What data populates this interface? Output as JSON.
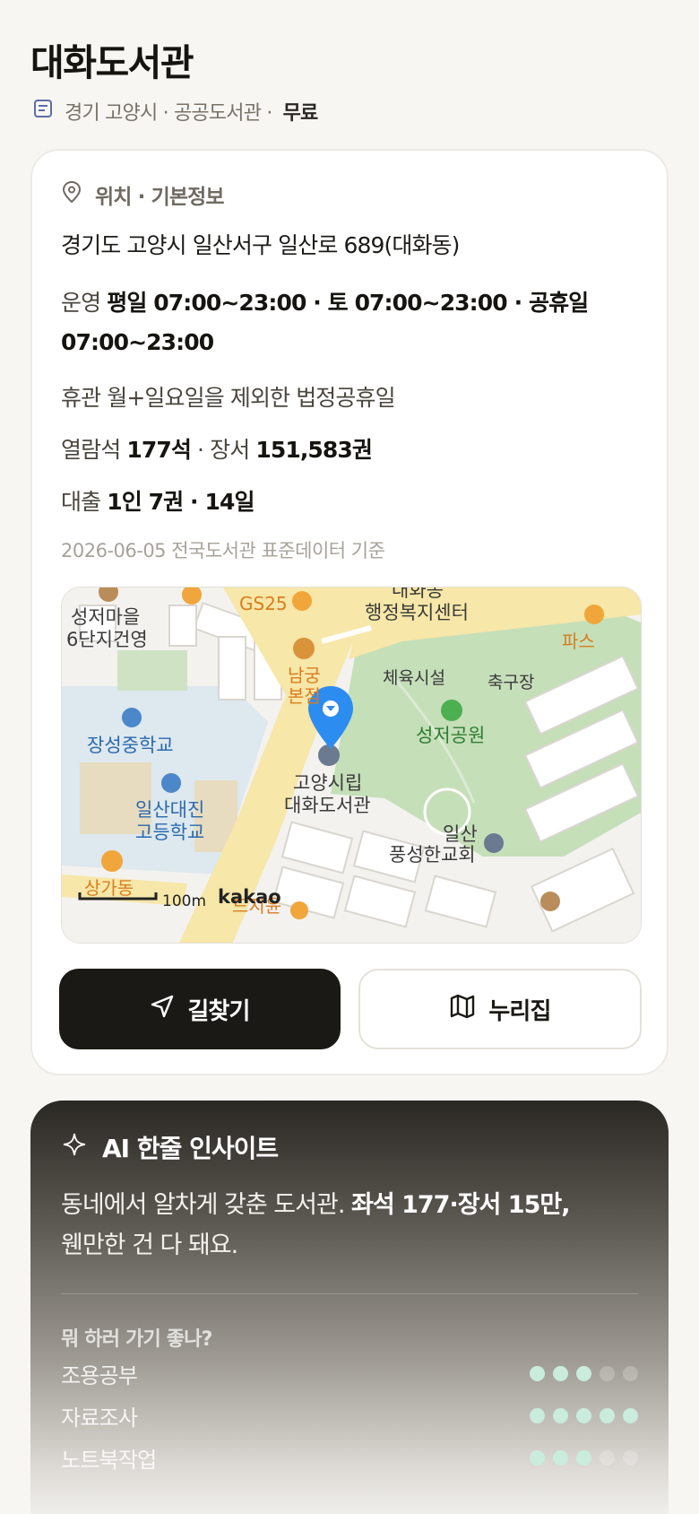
{
  "library": {
    "name": "대화도서관",
    "meta_region": "경기 고양시 · 공공도서관 ·",
    "meta_fee": "무료"
  },
  "info": {
    "section_title": "위치 · 기본정보",
    "address": "경기도 고양시 일산서구 일산로 689(대화동)",
    "hours_label": "운영",
    "hours_line1": "평일 07:00~23:00 · 토 07:00~23:00 · 공휴일",
    "hours_line2": "07:00~23:00",
    "closed_label": "휴관",
    "closed_value": "월+일요일을 제외한 법정공휴일",
    "seats_label": "열람석",
    "seats_value": "177석",
    "books_label": "· 장서",
    "books_value": "151,583권",
    "loan_label": "대출",
    "loan_value": "1인 7권 · 14일",
    "source": "2026-06-05 전국도서관 표준데이터 기준"
  },
  "map": {
    "labels": {
      "apt": "성저마을\n6단지건영",
      "gs25": "GS25",
      "office_top": "대화동",
      "office": "행정복지센터",
      "pasu": "파스",
      "restaurant": "남궁\n본점",
      "sports": "체육시설",
      "soccer": "축구장",
      "park": "성저공원",
      "middle_school": "장성중학교",
      "high_school": "일산대진\n고등학교",
      "library": "고양시립\n대화도서관",
      "church": "일산\n풍성한교회",
      "shop": "상가동",
      "bottom_shop": "드지윤",
      "scale": "100m",
      "brand": "kakao"
    }
  },
  "buttons": {
    "directions": "길찾기",
    "nurijip": "누리집"
  },
  "ai": {
    "title": "AI 한줄 인사이트",
    "text_normal": "동네에서 알차게 갖춘 도서관.",
    "text_bold": "좌석 177·장서 15만,",
    "text_line2": "웬만한 건 다 돼요.",
    "question": "뭐 하러 가기 좋나?",
    "ratings": [
      {
        "label": "조용공부",
        "score": 3,
        "max": 5
      },
      {
        "label": "자료조사",
        "score": 5,
        "max": 5
      },
      {
        "label": "노트북작업",
        "score": 3,
        "max": 5
      }
    ]
  },
  "colors": {
    "background": "#f7f6f3",
    "accent_dark": "#1b1915",
    "map_pin": "#2d8cf0",
    "rating_on": "#c9ecdc"
  }
}
